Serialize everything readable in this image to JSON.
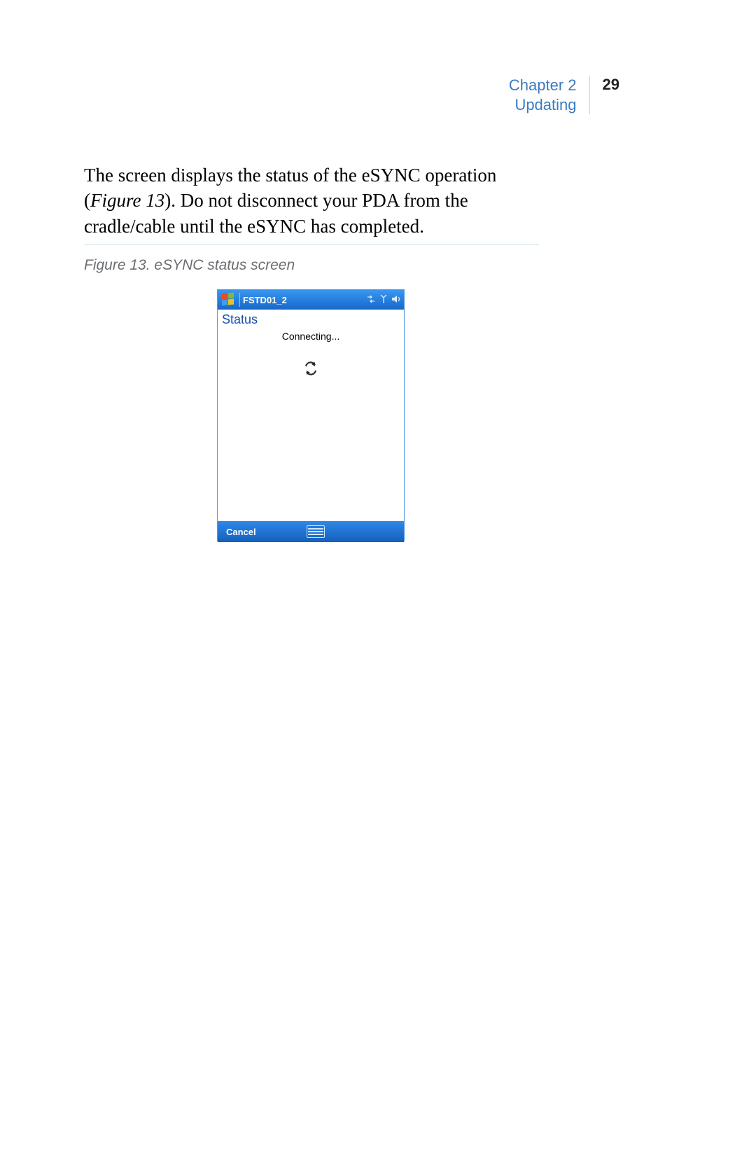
{
  "header": {
    "chapter_line1": "Chapter 2",
    "chapter_line2": "Updating",
    "page_number": "29"
  },
  "body": {
    "sentence_part1": "The screen displays the status of the eSYNC operation (",
    "figure_ref": "Figure 13",
    "sentence_part2": "). Do not disconnect your PDA from the cradle/cable until the eSYNC has completed."
  },
  "caption": "Figure 13.  eSYNC status screen",
  "pda": {
    "title": "FSTD01_2",
    "status_label": "Status",
    "status_text": "Connecting...",
    "cancel": "Cancel"
  }
}
